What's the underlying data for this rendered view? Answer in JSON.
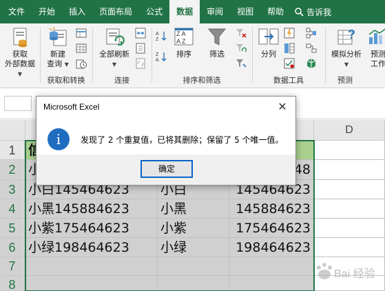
{
  "tabs": [
    {
      "label": "文件",
      "active": false
    },
    {
      "label": "开始",
      "active": false
    },
    {
      "label": "插入",
      "active": false
    },
    {
      "label": "页面布局",
      "active": false
    },
    {
      "label": "公式",
      "active": false
    },
    {
      "label": "数据",
      "active": true
    },
    {
      "label": "审阅",
      "active": false
    },
    {
      "label": "视图",
      "active": false
    },
    {
      "label": "帮助",
      "active": false
    }
  ],
  "tell_me": "告诉我",
  "ribbon": {
    "get_external_line1": "获取",
    "get_external_line2": "外部数据",
    "new_query_line1": "新建",
    "new_query_line2": "查询",
    "group_get_transform": "获取和转换",
    "refresh_all": "全部刷新",
    "group_connections": "连接",
    "sort": "排序",
    "filter": "筛选",
    "group_sort_filter": "排序和筛选",
    "split": "分列",
    "group_data_tools": "数据工具",
    "what_if": "模拟分析",
    "forecast_line1": "预测",
    "forecast_line2": "工作",
    "group_forecast": "预测"
  },
  "columns": {
    "d": "D"
  },
  "rows": [
    "1",
    "2",
    "3",
    "4",
    "5",
    "6",
    "7",
    "8"
  ],
  "header_row": {
    "a": "信"
  },
  "data": [
    {
      "a": "小",
      "b": "",
      "c": "48"
    },
    {
      "a": "小白145464623",
      "b": "小白",
      "c": "145464623"
    },
    {
      "a": "小黑145884623",
      "b": "小黑",
      "c": "145884623"
    },
    {
      "a": "小紫175464623",
      "b": "小紫",
      "c": "175464623"
    },
    {
      "a": "小绿198464623",
      "b": "小绿",
      "c": "198464623"
    }
  ],
  "dialog": {
    "title": "Microsoft Excel",
    "close": "✕",
    "message": "发现了 2 个重复值，已将其删除；保留了 5 个唯一值。",
    "ok": "确定",
    "info_glyph": "i"
  },
  "watermark": "Bai 经验",
  "colors": {
    "excel_green": "#217346",
    "header_fill": "#a9d08e",
    "info_blue": "#1f6dc1",
    "focus_blue": "#0a64c8"
  }
}
